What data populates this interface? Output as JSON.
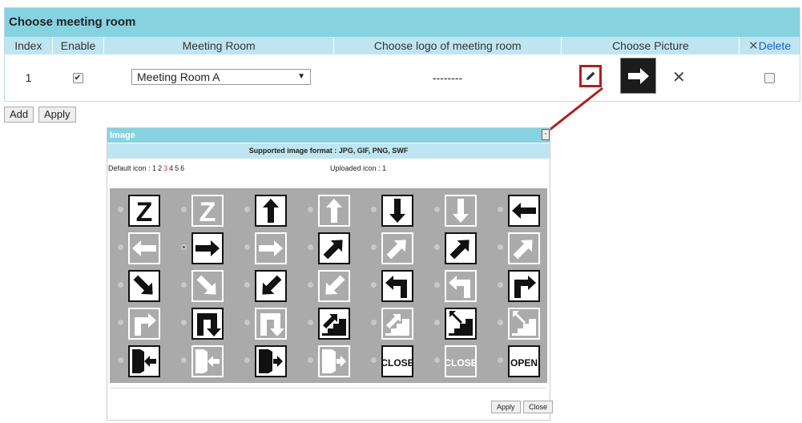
{
  "panel": {
    "title": "Choose meeting room",
    "headers": {
      "index": "Index",
      "enable": "Enable",
      "meeting_room": "Meeting Room",
      "logo": "Choose logo of meeting room",
      "picture": "Choose Picture",
      "delete_icon": "✕",
      "delete": "Delete"
    },
    "row": {
      "index": "1",
      "enabled": true,
      "room_value": "Meeting Room A",
      "logo_value": "--------",
      "remove_symbol": "✕",
      "delete_checked": false
    }
  },
  "buttons": {
    "add": "Add",
    "apply": "Apply"
  },
  "dialog": {
    "title": "Image",
    "formats": "Supported image format : JPG, GIF, PNG, SWF",
    "default_icon_label": "Default icon :",
    "pages": [
      "1",
      "2",
      "3",
      "4",
      "5",
      "6"
    ],
    "active_page": "3",
    "uploaded_icon_label": "Uploaded icon :",
    "uploaded_pages": [
      "1"
    ],
    "apply": "Apply",
    "close": "Close"
  },
  "icon_grid": [
    [
      "z-icon",
      "z-light-icon",
      "arrow-up-icon",
      "arrow-up-light-icon",
      "arrow-down-icon",
      "arrow-down-light-icon",
      "arrow-left-icon"
    ],
    [
      "arrow-left-light-icon",
      "arrow-right-icon",
      "arrow-right-light-icon",
      "arrow-up-left-icon",
      "arrow-up-left-light-icon",
      "arrow-up-right-icon",
      "arrow-up-right-light-icon"
    ],
    [
      "arrow-down-left-icon",
      "arrow-down-left-light-icon",
      "arrow-down-right-icon",
      "arrow-down-right-light-icon",
      "turn-left-icon",
      "turn-left-light-icon",
      "turn-right-icon"
    ],
    [
      "turn-right-light-icon",
      "u-turn-icon",
      "u-turn-light-icon",
      "stairs-up-icon",
      "stairs-up-light-icon",
      "stairs-down-icon",
      "stairs-down-light-icon"
    ],
    [
      "door-enter-icon",
      "door-enter-light-icon",
      "door-exit-icon",
      "door-exit-light-icon",
      "close-sign-icon",
      "close-sign-light-icon",
      "open-sign-icon"
    ]
  ],
  "selected_icon": "arrow-right-icon",
  "sign_texts": {
    "close": "CLOSE",
    "open": "OPEN"
  },
  "colors": {
    "header": "#86d2e1",
    "subheader": "#bfe6f0",
    "highlight": "#b01e1e",
    "link": "#1a5fd0"
  }
}
